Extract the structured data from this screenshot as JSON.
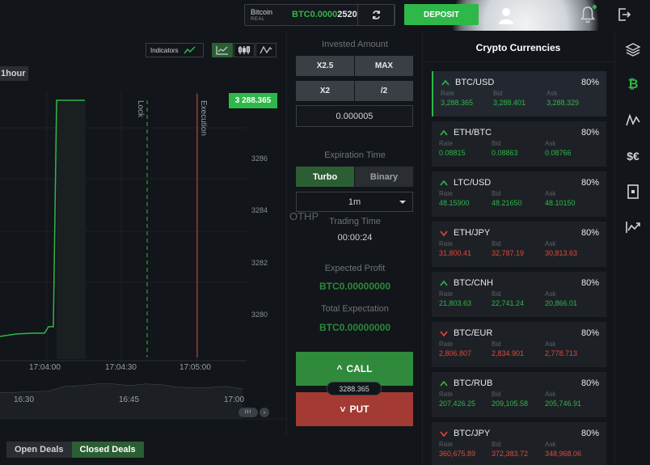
{
  "topbar": {
    "account_label": "Bitcoin",
    "account_type": "REAL",
    "balance_prefix": "BTC0.0000",
    "balance_suffix": "2520",
    "deposit_label": "DEPOSIT"
  },
  "chart": {
    "indicators_label": "Indicators",
    "timeframe": "1hour",
    "current_price": "3 288.365",
    "y_ticks": [
      "3286",
      "3284",
      "3282",
      "3280"
    ],
    "lock_label": "Lock",
    "execution_label": "Execution",
    "time_ticks": [
      "17:04:00",
      "17:04:30",
      "17:05:00"
    ],
    "nav_ticks": [
      "16:30",
      "16:45",
      "17:00"
    ],
    "scroll_knob": "III",
    "scroll_arrow": "›"
  },
  "deals": {
    "open_label": "Open Deals",
    "closed_label": "Closed Deals"
  },
  "trade": {
    "invested_title": "Invested Amount",
    "quick": [
      "X2.5",
      "MAX",
      "X2",
      "/2"
    ],
    "amount": "0.000005",
    "expiration_title": "Expiration Time",
    "mode_on": "Turbo",
    "mode_off": "Binary",
    "duration": "1m",
    "ghost_text": "OTHP",
    "trading_time_title": "Trading Time",
    "trading_time": "00:00:24",
    "expected_profit_title": "Expected Profit",
    "expected_profit": "BTC0.00000000",
    "total_expectation_title": "Total Expectation",
    "total_expectation": "BTC0.00000000",
    "call_label": "CALL",
    "put_label": "PUT",
    "mid_price": "3288.365",
    "call_arrow": "^",
    "put_arrow": "˅"
  },
  "crypto": {
    "title": "Crypto Currencies",
    "rate_label": "Rate",
    "bid_label": "Bid",
    "ask_label": "Ask",
    "items": [
      {
        "symbol": "BTC/USD",
        "percent": "80%",
        "direction": "up",
        "rate": "3,288.365",
        "bid": "3,288.401",
        "ask": "3,288.329"
      },
      {
        "symbol": "ETH/BTC",
        "percent": "80%",
        "direction": "up",
        "rate": "0.08815",
        "bid": "0.08863",
        "ask": "0.08766"
      },
      {
        "symbol": "LTC/USD",
        "percent": "80%",
        "direction": "up",
        "rate": "48.15900",
        "bid": "48.21650",
        "ask": "48.10150"
      },
      {
        "symbol": "ETH/JPY",
        "percent": "80%",
        "direction": "down",
        "rate": "31,800.41",
        "bid": "32,787.19",
        "ask": "30,813.63"
      },
      {
        "symbol": "BTC/CNH",
        "percent": "80%",
        "direction": "up",
        "rate": "21,803.63",
        "bid": "22,741.24",
        "ask": "20,866.01"
      },
      {
        "symbol": "BTC/EUR",
        "percent": "80%",
        "direction": "down",
        "rate": "2,806.807",
        "bid": "2,834.901",
        "ask": "2,778.713"
      },
      {
        "symbol": "BTC/RUB",
        "percent": "80%",
        "direction": "up",
        "rate": "207,426.25",
        "bid": "209,105.58",
        "ask": "205,746.91"
      },
      {
        "symbol": "BTC/JPY",
        "percent": "80%",
        "direction": "down",
        "rate": "360,675.89",
        "bid": "372,383.72",
        "ask": "348,968.06"
      }
    ]
  },
  "sidebar": {
    "bitcoin_glyph": "₿",
    "currency_glyph": "$€"
  },
  "colors": {
    "green": "#31b548",
    "red": "#e0483c",
    "accent": "#2fb84a"
  }
}
